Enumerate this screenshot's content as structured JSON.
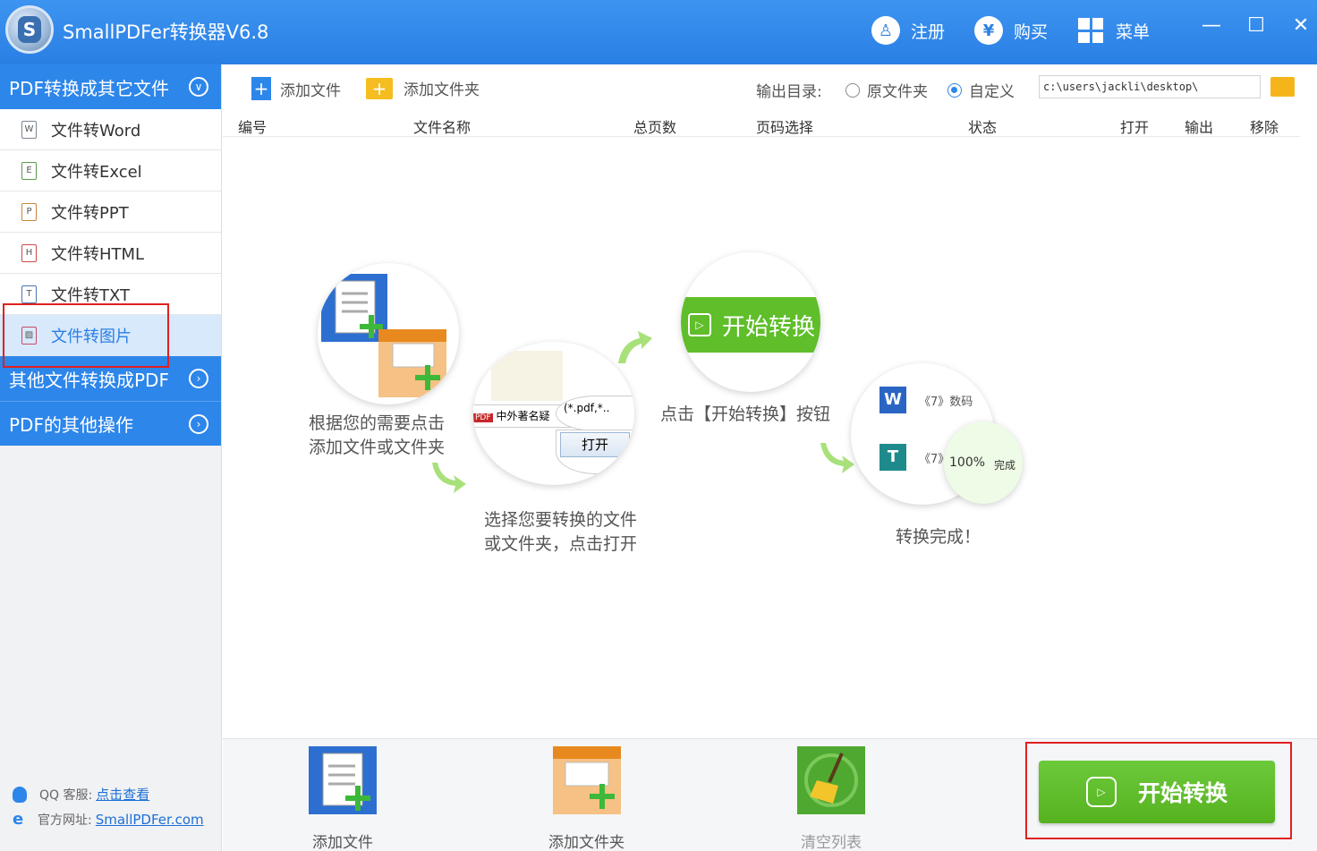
{
  "app": {
    "title": "SmallPDFer转换器V6.8"
  },
  "titlebar": {
    "register": "注册",
    "buy": "购买",
    "menu": "菜单",
    "minimize": "—",
    "maximize": "☐",
    "close": "✕"
  },
  "sidebar": {
    "section1": "PDF转换成其它文件",
    "items": [
      {
        "label": "文件转Word",
        "icon": "W"
      },
      {
        "label": "文件转Excel",
        "icon": "E"
      },
      {
        "label": "文件转PPT",
        "icon": "P"
      },
      {
        "label": "文件转HTML",
        "icon": "H"
      },
      {
        "label": "文件转TXT",
        "icon": "T"
      },
      {
        "label": "文件转图片",
        "icon": "▨"
      }
    ],
    "section2": "其他文件转换成PDF",
    "section3": "PDF的其他操作",
    "qq_label": "QQ 客服:",
    "qq_link": "点击查看",
    "site_label": "官方网址:",
    "site_link": "SmallPDFer.com"
  },
  "toolbar": {
    "add_file": "添加文件",
    "add_folder": "添加文件夹",
    "output_label": "输出目录:",
    "radio_original": "原文件夹",
    "radio_custom": "自定义",
    "output_path": "c:\\users\\jackli\\desktop\\"
  },
  "table": {
    "headers": [
      "编号",
      "文件名称",
      "总页数",
      "页码选择",
      "状态",
      "打开",
      "输出",
      "移除"
    ]
  },
  "steps": {
    "step1": [
      "根据您的需要点击",
      "添加文件或文件夹"
    ],
    "step2": [
      "选择您要转换的文件",
      "或文件夹，点击打开"
    ],
    "step2_file": "中外著名疑",
    "step2_filter": "(*.pdf,*..",
    "step2_open": "打开",
    "step3": "点击【开始转换】按钮",
    "step3_button": "开始转换",
    "step4": "转换完成！",
    "step4_item1": "《7》数码",
    "step4_item2": "《7》",
    "step4_progress": "100%",
    "step4_done": "完成"
  },
  "bottom": {
    "add_file": "添加文件",
    "add_folder": "添加文件夹",
    "clear": "清空列表",
    "start": "开始转换"
  },
  "colors": {
    "brand_blue": "#2d86ea",
    "green": "#5fbe2a",
    "highlight_red": "#e02020"
  }
}
